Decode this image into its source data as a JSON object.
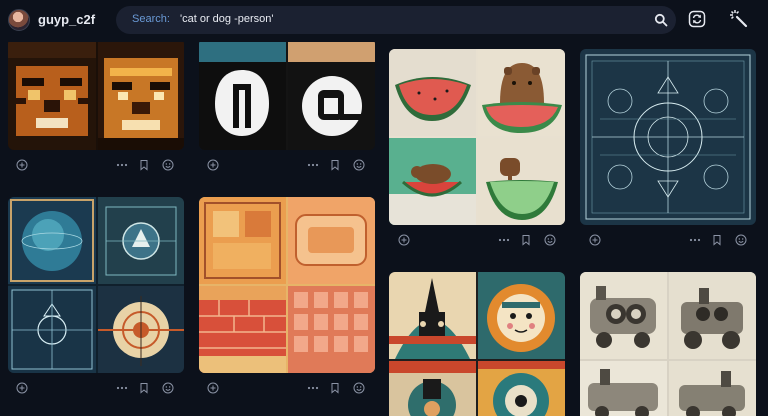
{
  "user": {
    "name": "guyp_c2f"
  },
  "search": {
    "label": "Search:",
    "query": "'cat or dog -person'"
  },
  "icons": {
    "search": "search-icon",
    "refresh": "refresh-icon",
    "magic": "magic-wand-icon",
    "add": "add-circle-icon",
    "more": "more-icon",
    "bookmark": "bookmark-icon",
    "smiley": "smiley-icon"
  },
  "colors": {
    "background": "#0c111b",
    "searchbar": "#1b2131",
    "accent": "#6a9ad6"
  },
  "gallery": [
    {
      "name": "tigers-pixel"
    },
    {
      "name": "logo-shapes"
    },
    {
      "name": "capybara-watermelon"
    },
    {
      "name": "blueprint-diagram"
    },
    {
      "name": "blue-circuit-targets"
    },
    {
      "name": "orange-tiles"
    },
    {
      "name": "retro-robot-posters"
    },
    {
      "name": "steam-train-sketches"
    }
  ]
}
